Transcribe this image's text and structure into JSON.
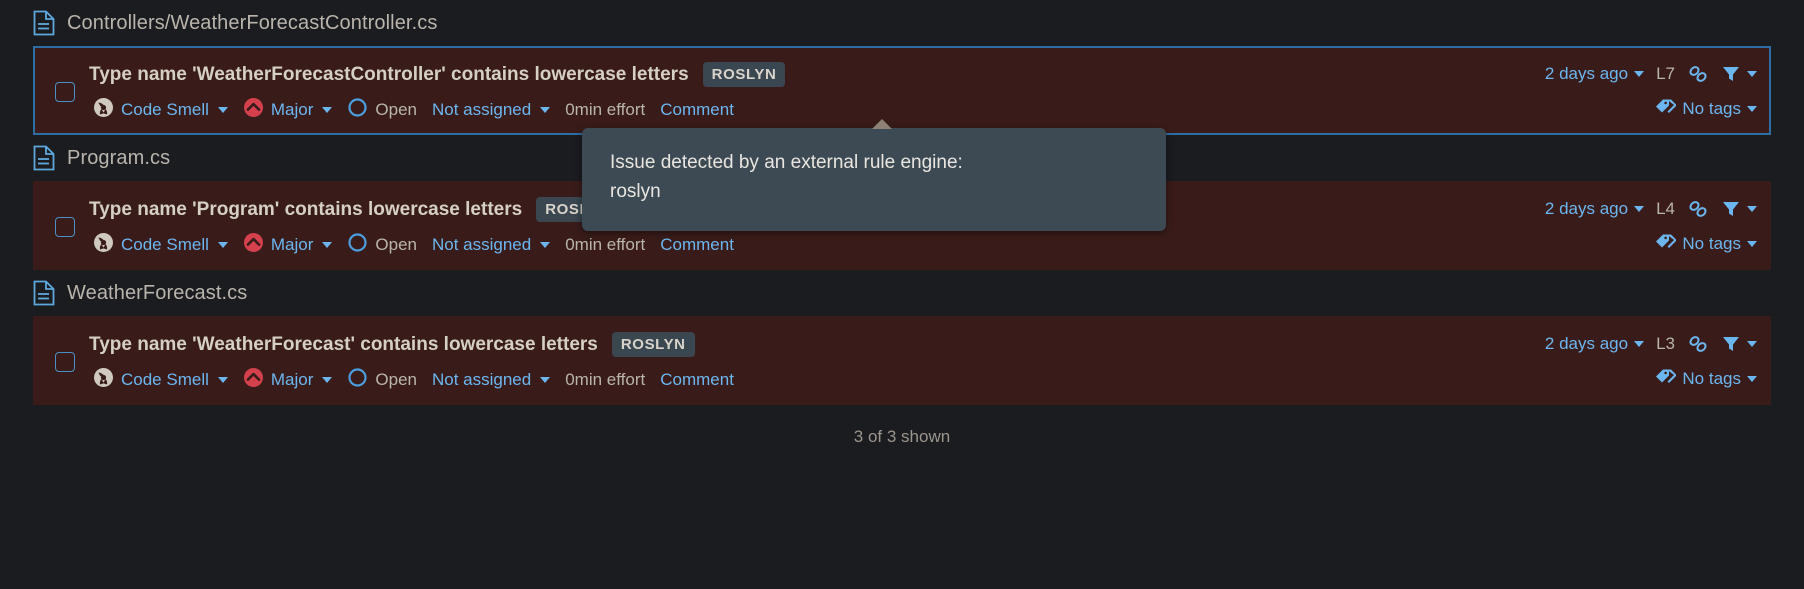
{
  "groups": [
    {
      "file_icon": "file-icon",
      "file_name": "Controllers/WeatherForecastController.cs",
      "issue": {
        "message": "Type name 'WeatherForecastController' contains lowercase letters",
        "engine_badge": "ROSLYN",
        "type_icon": "code-smell-icon",
        "type": "Code Smell",
        "severity_icon": "severity-major-icon",
        "severity": "Major",
        "status_icon": "status-open-icon",
        "status": "Open",
        "assignee": "Not assigned",
        "effort": "0min effort",
        "comment": "Comment",
        "updated": "2 days ago",
        "line": "L7",
        "link_icon": "link-icon",
        "filter_icon": "filter-icon",
        "tag_icon": "tag-icon",
        "tags": "No tags",
        "selected": true
      }
    },
    {
      "file_icon": "file-icon",
      "file_name": "Program.cs",
      "issue": {
        "message": "Type name 'Program' contains lowercase letters",
        "engine_badge": "ROSLYN",
        "type_icon": "code-smell-icon",
        "type": "Code Smell",
        "severity_icon": "severity-major-icon",
        "severity": "Major",
        "status_icon": "status-open-icon",
        "status": "Open",
        "assignee": "Not assigned",
        "effort": "0min effort",
        "comment": "Comment",
        "updated": "2 days ago",
        "line": "L4",
        "link_icon": "link-icon",
        "filter_icon": "filter-icon",
        "tag_icon": "tag-icon",
        "tags": "No tags",
        "selected": false
      }
    },
    {
      "file_icon": "file-icon",
      "file_name": "WeatherForecast.cs",
      "issue": {
        "message": "Type name 'WeatherForecast' contains lowercase letters",
        "engine_badge": "ROSLYN",
        "type_icon": "code-smell-icon",
        "type": "Code Smell",
        "severity_icon": "severity-major-icon",
        "severity": "Major",
        "status_icon": "status-open-icon",
        "status": "Open",
        "assignee": "Not assigned",
        "effort": "0min effort",
        "comment": "Comment",
        "updated": "2 days ago",
        "line": "L3",
        "link_icon": "link-icon",
        "filter_icon": "filter-icon",
        "tag_icon": "tag-icon",
        "tags": "No tags",
        "selected": false
      }
    }
  ],
  "tooltip": {
    "line1": "Issue detected by an external rule engine:",
    "line2": "roslyn"
  },
  "footer": {
    "shown": "3 of 3 shown"
  },
  "colors": {
    "page_bg": "#1b1c20",
    "card_bg": "#391c1a",
    "selected_border": "#2e6da4",
    "link_blue": "#6cb6f0",
    "text_grey": "#b9b4ac",
    "badge_bg": "#3a4650",
    "tooltip_bg": "#3d4a53",
    "severity_red": "#d4333f"
  }
}
